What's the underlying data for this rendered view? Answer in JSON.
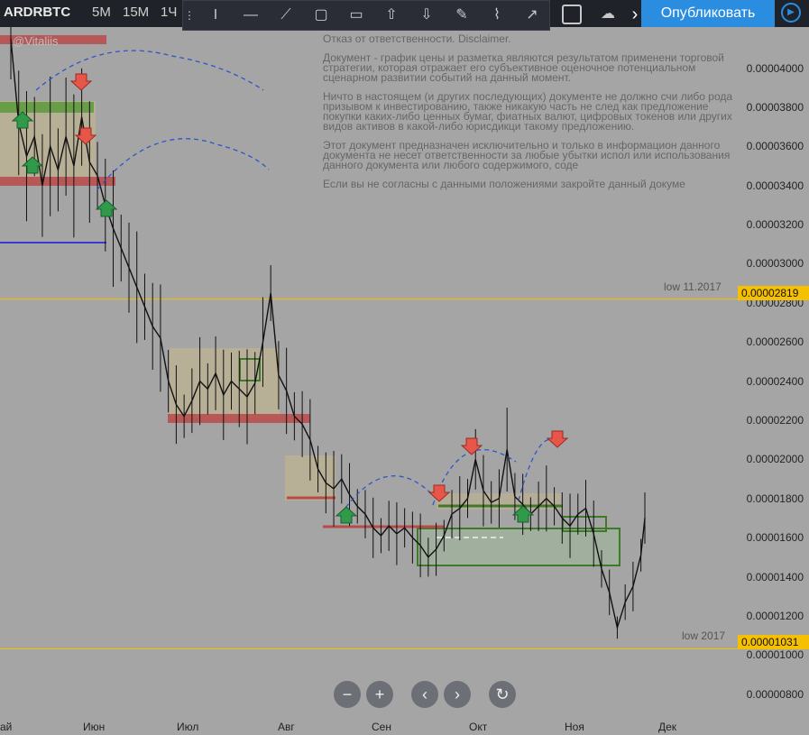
{
  "header": {
    "symbol": "ARDRBTC",
    "timeframes": [
      "5М",
      "15М",
      "1Ч"
    ],
    "publish_label": "Опубликовать",
    "tools": [
      "text-cursor-icon",
      "horizontal-ray-icon",
      "trend-line-icon",
      "rectangle-icon",
      "callout-icon",
      "arrow-up-icon",
      "arrow-down-icon",
      "brush-icon",
      "path-icon",
      "arrow-line-icon"
    ]
  },
  "watermark": "@Vitaliis",
  "disclaimer": [
    "Отказ от ответственности. Disclaimer.",
    "Документ - график цены и разметка являются результатом применени торговой стратегии, которая отражает его субъективное оценочное потенциальном сценарном развитии событий на данный момент.",
    "Ничто в настоящем (и других последующих) документе не должно счи либо рода призывом к инвестированию, также никакую часть не след как предложение покупки каких-либо ценных бумаг, фиатных валют, цифровых токенов или других видов активов в какой-либо юрисдикци такому предложению.",
    "Этот документ предназначен исключительно и только в информацион данного документа не несет ответственности за любые убытки испол или использования данного документа или любого содержимого, соде",
    "Если вы не согласны с данными положениями закройте данный докуме"
  ],
  "chart_data": {
    "type": "line",
    "symbol": "ARDRBTC",
    "x_ticks": [
      "ай",
      "Июн",
      "Июл",
      "Авг",
      "Сен",
      "Окт",
      "Ноя",
      "Дек"
    ],
    "y_ticks": [
      "0.00004000",
      "0.00003800",
      "0.00003600",
      "0.00003400",
      "0.00003200",
      "0.00003000",
      "0.00002800",
      "0.00002600",
      "0.00002400",
      "0.00002200",
      "0.00002000",
      "0.00001800",
      "0.00001600",
      "0.00001400",
      "0.00001200",
      "0.00001000",
      "0.00000800"
    ],
    "ylim": [
      7.2e-06,
      4.21e-05
    ],
    "series": [
      {
        "values": [
          [
            0,
            4.15e-05
          ],
          [
            2,
            3.72e-05
          ],
          [
            4,
            3.55e-05
          ],
          [
            6,
            3.65e-05
          ],
          [
            8,
            3.4e-05
          ],
          [
            10,
            3.6e-05
          ],
          [
            12,
            3.48e-05
          ],
          [
            14,
            3.65e-05
          ],
          [
            16,
            3.5e-05
          ],
          [
            18,
            3.75e-05
          ],
          [
            20,
            3.52e-05
          ],
          [
            22,
            3.45e-05
          ],
          [
            24,
            3.3e-05
          ],
          [
            26,
            3.18e-05
          ],
          [
            28,
            3.08e-05
          ],
          [
            30,
            2.98e-05
          ],
          [
            32,
            2.88e-05
          ],
          [
            34,
            2.78e-05
          ],
          [
            36,
            2.68e-05
          ],
          [
            38,
            2.62e-05
          ],
          [
            40,
            2.4e-05
          ],
          [
            42,
            2.28e-05
          ],
          [
            44,
            2.22e-05
          ],
          [
            46,
            2.3e-05
          ],
          [
            48,
            2.4e-05
          ],
          [
            50,
            2.36e-05
          ],
          [
            52,
            2.44e-05
          ],
          [
            54,
            2.33e-05
          ],
          [
            56,
            2.4e-05
          ],
          [
            58,
            2.36e-05
          ],
          [
            60,
            2.32e-05
          ],
          [
            62,
            2.39e-05
          ],
          [
            64,
            2.6e-05
          ],
          [
            66,
            2.85e-05
          ],
          [
            68,
            2.43e-05
          ],
          [
            70,
            2.35e-05
          ],
          [
            72,
            2.22e-05
          ],
          [
            74,
            2.18e-05
          ],
          [
            76,
            2.1e-05
          ],
          [
            78,
            1.95e-05
          ],
          [
            80,
            1.88e-05
          ],
          [
            82,
            1.85e-05
          ],
          [
            84,
            1.9e-05
          ],
          [
            86,
            1.82e-05
          ],
          [
            88,
            1.76e-05
          ],
          [
            90,
            1.72e-05
          ],
          [
            92,
            1.65e-05
          ],
          [
            94,
            1.61e-05
          ],
          [
            96,
            1.66e-05
          ],
          [
            98,
            1.62e-05
          ],
          [
            100,
            1.65e-05
          ],
          [
            102,
            1.6e-05
          ],
          [
            104,
            1.56e-05
          ],
          [
            106,
            1.5e-05
          ],
          [
            108,
            1.54e-05
          ],
          [
            110,
            1.61e-05
          ],
          [
            112,
            1.72e-05
          ],
          [
            114,
            1.75e-05
          ],
          [
            116,
            1.8e-05
          ],
          [
            118,
            2e-05
          ],
          [
            120,
            1.84e-05
          ],
          [
            122,
            1.78e-05
          ],
          [
            124,
            1.8e-05
          ],
          [
            126,
            2.05e-05
          ],
          [
            128,
            1.81e-05
          ],
          [
            130,
            1.77e-05
          ],
          [
            132,
            1.72e-05
          ],
          [
            134,
            1.76e-05
          ],
          [
            136,
            1.8e-05
          ],
          [
            138,
            1.76e-05
          ],
          [
            140,
            1.7e-05
          ],
          [
            142,
            1.66e-05
          ],
          [
            144,
            1.72e-05
          ],
          [
            146,
            1.75e-05
          ],
          [
            148,
            1.62e-05
          ],
          [
            150,
            1.44e-05
          ],
          [
            152,
            1.32e-05
          ],
          [
            154,
            1.14e-05
          ],
          [
            156,
            1.27e-05
          ],
          [
            158,
            1.35e-05
          ],
          [
            160,
            1.51e-05
          ],
          [
            161,
            1.7e-05
          ]
        ]
      }
    ],
    "levels": [
      {
        "label": "low 11.2017",
        "value": 2.819e-05,
        "tag": "0.00002819"
      },
      {
        "label": "low 2017",
        "value": 1.031e-05,
        "tag": "0.00001031"
      }
    ]
  },
  "nav": [
    "zoom-out-icon",
    "zoom-in-icon",
    "scroll-left-icon",
    "scroll-right-icon",
    "reset-icon"
  ],
  "nav_glyphs": [
    "−",
    "+",
    "‹",
    "›",
    "↻"
  ]
}
